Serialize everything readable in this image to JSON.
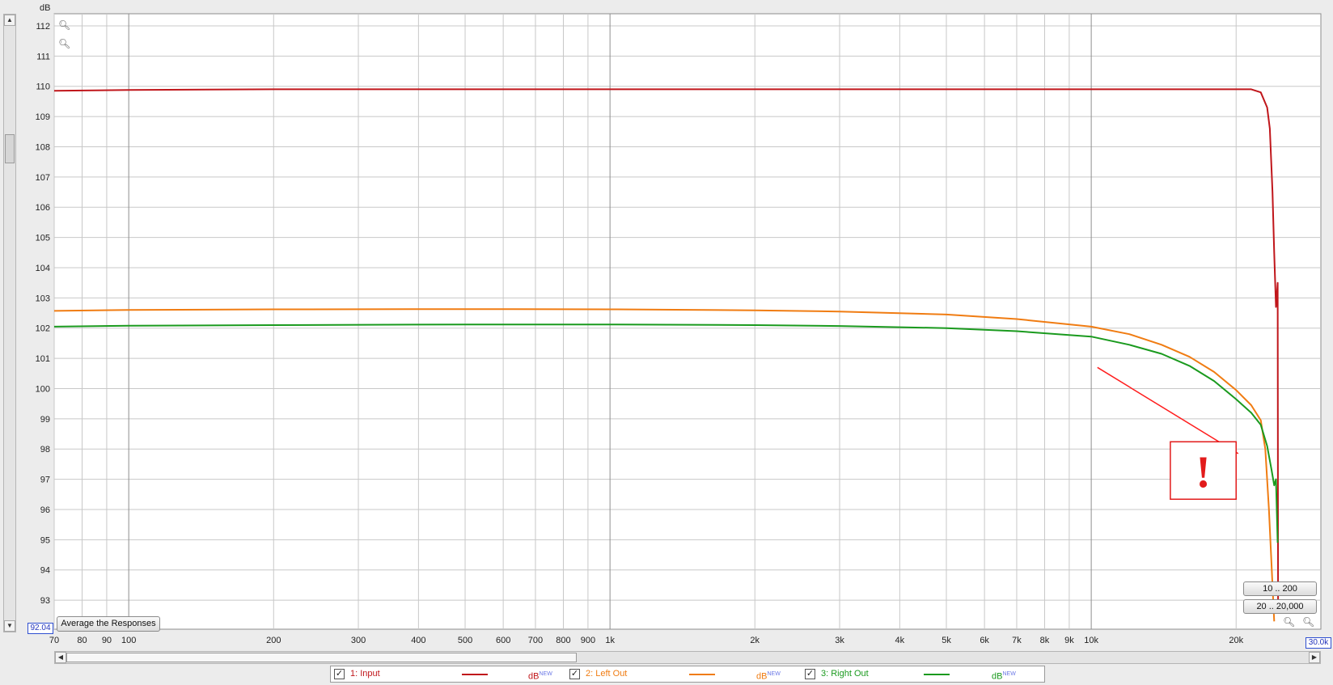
{
  "chart_data": {
    "type": "line",
    "ylabel": "dB",
    "xscale": "log",
    "xlim": [
      70,
      30000
    ],
    "ylim": [
      92.04,
      112.4
    ],
    "grid": true,
    "x_ticks": [
      70,
      80,
      90,
      100,
      200,
      300,
      400,
      500,
      600,
      700,
      800,
      900,
      1000,
      2000,
      3000,
      4000,
      5000,
      6000,
      7000,
      8000,
      9000,
      10000,
      20000
    ],
    "x_tick_labels": [
      "70",
      "80",
      "90",
      "100",
      "200",
      "300",
      "400",
      "500",
      "600",
      "700",
      "800",
      "900",
      "1k",
      "2k",
      "3k",
      "4k",
      "5k",
      "6k",
      "7k",
      "8k",
      "9k",
      "10k",
      "20k"
    ],
    "y_ticks": [
      93,
      94,
      95,
      96,
      97,
      98,
      99,
      100,
      101,
      102,
      103,
      104,
      105,
      106,
      107,
      108,
      109,
      110,
      111,
      112
    ],
    "series": [
      {
        "name": "1: Input",
        "color": "#c0161b",
        "x": [
          70,
          100,
          200,
          500,
          1000,
          2000,
          5000,
          10000,
          15000,
          18000,
          20000,
          21500,
          22500,
          23200,
          23500,
          23800,
          24000,
          24200,
          24400,
          24450
        ],
        "y": [
          109.85,
          109.88,
          109.9,
          109.9,
          109.9,
          109.9,
          109.9,
          109.9,
          109.9,
          109.9,
          109.9,
          109.9,
          109.8,
          109.3,
          108.6,
          106.5,
          104.5,
          102.7,
          103.5,
          93
        ]
      },
      {
        "name": "2: Left Out",
        "color": "#f07c12",
        "x": [
          70,
          100,
          200,
          500,
          1000,
          2000,
          3000,
          5000,
          7000,
          10000,
          12000,
          14000,
          16000,
          18000,
          20000,
          21500,
          22500,
          23000,
          23400,
          23800,
          24000
        ],
        "y": [
          102.57,
          102.6,
          102.62,
          102.63,
          102.62,
          102.59,
          102.55,
          102.45,
          102.3,
          102.05,
          101.8,
          101.45,
          101.05,
          100.55,
          99.95,
          99.45,
          98.95,
          98.0,
          96.0,
          93.5,
          92.3
        ]
      },
      {
        "name": "3: Right Out",
        "color": "#1a9a1e",
        "x": [
          70,
          100,
          200,
          500,
          1000,
          2000,
          3000,
          5000,
          7000,
          10000,
          12000,
          14000,
          16000,
          18000,
          20000,
          21500,
          22500,
          23200,
          23700,
          24000,
          24200,
          24400
        ],
        "y": [
          102.05,
          102.08,
          102.1,
          102.12,
          102.12,
          102.1,
          102.07,
          102.0,
          101.9,
          101.72,
          101.45,
          101.15,
          100.75,
          100.25,
          99.65,
          99.2,
          98.8,
          98.1,
          97.3,
          96.8,
          97.0,
          94.9
        ]
      }
    ],
    "annotations": [
      {
        "type": "arrow",
        "color": "#ff1d1d",
        "from": {
          "x": 10300,
          "y": 100.7
        },
        "to": {
          "x": 20200,
          "y": 97.85
        }
      },
      {
        "type": "boxed-text",
        "text": "!",
        "color": "#e21b1b",
        "x_range": [
          14600,
          20000
        ],
        "y_range": [
          96.34,
          98.24
        ]
      }
    ]
  },
  "controls": {
    "average_button": "Average the Responses",
    "zoom_preset_1": "10 .. 200",
    "zoom_preset_2": "20 .. 20,000",
    "y_min_readout": "92.04",
    "x_max_readout": "30.0k"
  },
  "legend": {
    "items": [
      {
        "label": "1: Input",
        "unit": "dB",
        "unit_sup": "NEW",
        "color": "#c0161b",
        "checked": true
      },
      {
        "label": "2: Left Out",
        "unit": "dB",
        "unit_sup": "NEW",
        "color": "#f07c12",
        "checked": true
      },
      {
        "label": "3: Right Out",
        "unit": "dB",
        "unit_sup": "NEW",
        "color": "#1a9a1e",
        "checked": true
      }
    ]
  }
}
